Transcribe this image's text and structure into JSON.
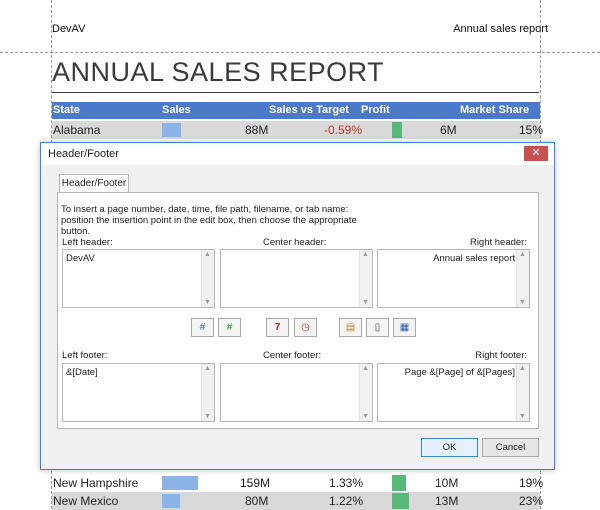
{
  "page": {
    "header_left": "DevAV",
    "header_right": "Annual sales report",
    "title": "ANNUAL SALES REPORT"
  },
  "table": {
    "columns": [
      "State",
      "Sales",
      "Sales vs Target",
      "Profit",
      "Market Share"
    ],
    "rows": [
      {
        "state": "Alabama",
        "sales": "88M",
        "vs_target": "-0.59%",
        "profit": "6M",
        "share": "15%"
      },
      {
        "state": "New Hampshire",
        "sales": "159M",
        "vs_target": "1.33%",
        "profit": "10M",
        "share": "19%"
      },
      {
        "state": "New Mexico",
        "sales": "80M",
        "vs_target": "1.22%",
        "profit": "13M",
        "share": "23%"
      }
    ]
  },
  "colors": {
    "header_blue": "#4a7ac9",
    "negative_red": "#c0392b",
    "bar_blue": "#8bb4e6",
    "bar_green": "#58b878",
    "dialog_accent": "#3a84d6"
  },
  "dialog": {
    "title": "Header/Footer",
    "close_label": "✕",
    "tab_label": "Header/Footer",
    "instructions": "To insert a page number, date, time, file path, filename, or tab name: position the insertion point in the edit box, then choose the appropriate button.",
    "left_header_label": "Left header:",
    "center_header_label": "Center header:",
    "right_header_label": "Right header:",
    "left_header_value": "DevAV",
    "center_header_value": "",
    "right_header_value": "Annual sales report",
    "left_footer_label": "Left footer:",
    "center_footer_label": "Center footer:",
    "right_footer_label": "Right footer:",
    "left_footer_value": "&[Date]",
    "center_footer_value": "",
    "right_footer_value": "Page &[Page] of &[Pages]",
    "ok_label": "OK",
    "cancel_label": "Cancel",
    "tools": [
      {
        "icon": "page-number-icon",
        "glyph": "#"
      },
      {
        "icon": "page-count-icon",
        "glyph": "#"
      },
      {
        "icon": "date-icon",
        "glyph": "7"
      },
      {
        "icon": "time-icon",
        "glyph": "◷"
      },
      {
        "icon": "file-path-icon",
        "glyph": "▤"
      },
      {
        "icon": "filename-icon",
        "glyph": "▯"
      },
      {
        "icon": "sheet-name-icon",
        "glyph": "▦"
      }
    ]
  }
}
